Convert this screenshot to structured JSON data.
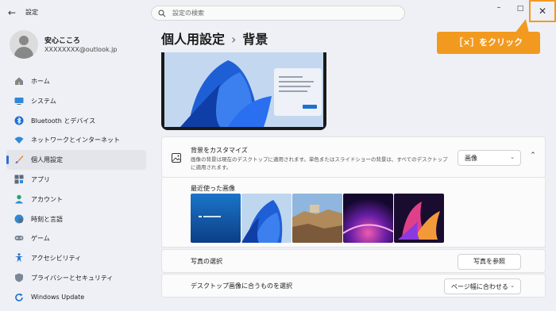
{
  "window": {
    "back_icon": "←",
    "title": "設定",
    "min_icon": "–",
    "max_icon": "□",
    "close_icon": "✕"
  },
  "search": {
    "placeholder": "設定の検索"
  },
  "callout": {
    "text": "［×］をクリック"
  },
  "profile": {
    "name": "安心こころ",
    "email": "XXXXXXXX@outlook.jp"
  },
  "nav": {
    "items": [
      {
        "label": "ホーム",
        "icon": "home-icon"
      },
      {
        "label": "システム",
        "icon": "monitor-icon"
      },
      {
        "label": "Bluetooth とデバイス",
        "icon": "bluetooth-icon"
      },
      {
        "label": "ネットワークとインターネット",
        "icon": "wifi-icon"
      },
      {
        "label": "個人用設定",
        "icon": "brush-icon",
        "selected": true
      },
      {
        "label": "アプリ",
        "icon": "apps-icon"
      },
      {
        "label": "アカウント",
        "icon": "account-icon"
      },
      {
        "label": "時刻と言語",
        "icon": "globe-clock-icon"
      },
      {
        "label": "ゲーム",
        "icon": "gamepad-icon"
      },
      {
        "label": "アクセシビリティ",
        "icon": "accessibility-icon"
      },
      {
        "label": "プライバシーとセキュリティ",
        "icon": "shield-icon"
      },
      {
        "label": "Windows Update",
        "icon": "update-icon"
      }
    ]
  },
  "breadcrumb": {
    "parent": "個人用設定",
    "separator": "›",
    "current": "背景"
  },
  "background": {
    "title": "背景をカスタマイズ",
    "description": "画像の背景は現在のデスクトップに適用されます。単色またはスライドショーの背景は、すべてのデスクトップに適用されます。",
    "type_value": "画像",
    "dropdown_icon": "⌄",
    "collapse_icon": "⌃"
  },
  "recent": {
    "label": "最近使った画像"
  },
  "photo": {
    "label": "写真の選択",
    "browse_button": "写真を参照"
  },
  "fit": {
    "label": "デスクトップ画像に合うものを選択",
    "value": "ページ幅に合わせる"
  },
  "colors": {
    "accent": "#2f6fd1",
    "callout": "#f29a1f"
  }
}
